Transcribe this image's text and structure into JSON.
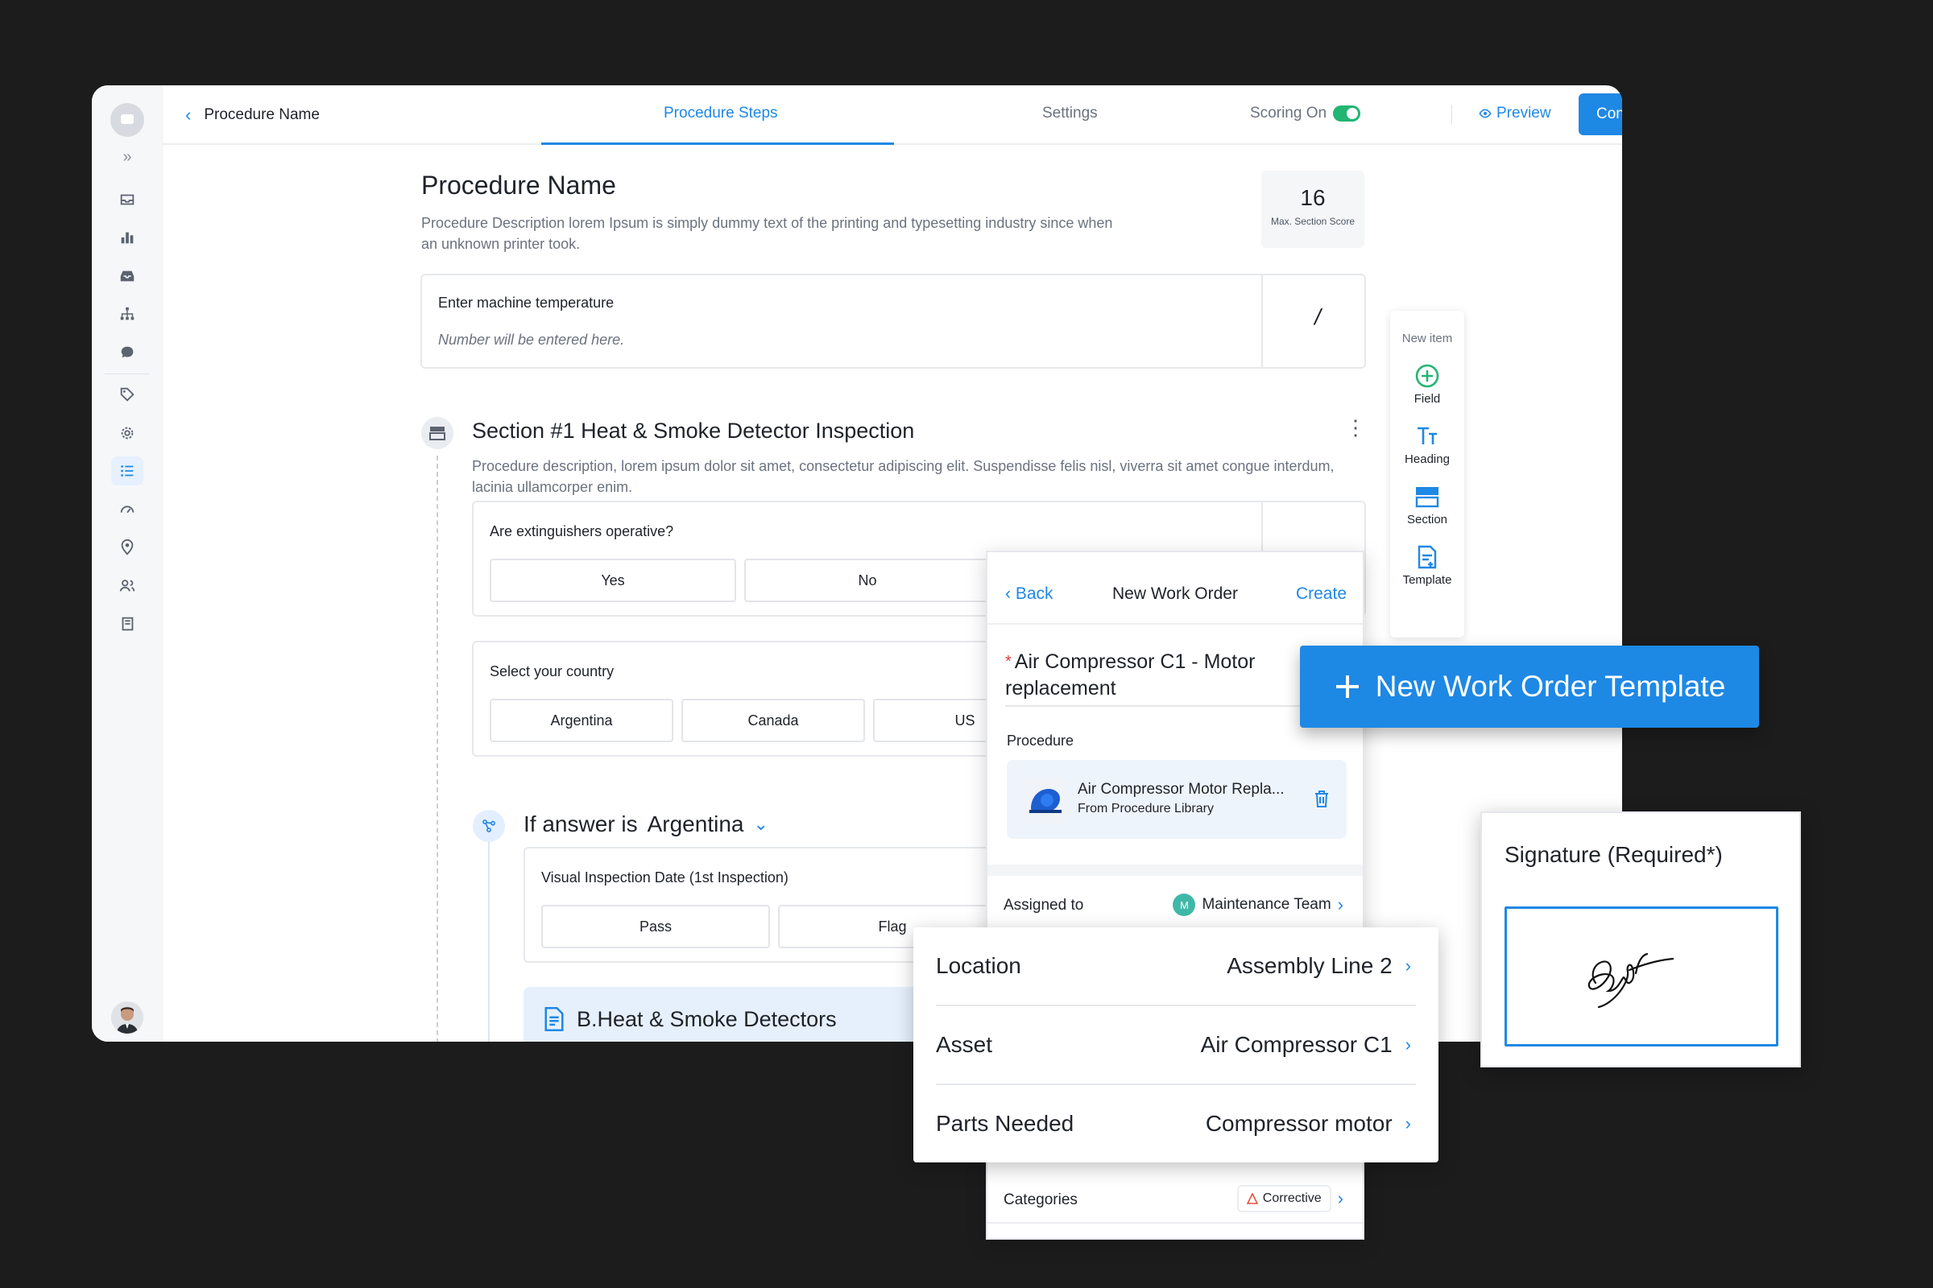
{
  "colors": {
    "accent": "#1e88e5",
    "toggle_on": "#22b573",
    "background": "#1c1c1c"
  },
  "topbar": {
    "back_label": "Procedure Name",
    "tabs": [
      {
        "label": "Procedure Steps",
        "active": true
      },
      {
        "label": "Settings",
        "active": false
      }
    ],
    "scoring_label": "Scoring On",
    "scoring_on": true,
    "preview_label": "Preview",
    "continue_label": "Continue"
  },
  "sidebar": {
    "icons": [
      "inbox-icon",
      "bar-chart-icon",
      "tray-icon",
      "hierarchy-icon",
      "chat-icon",
      "tag-icon",
      "gear-icon",
      "list-icon",
      "gauge-icon",
      "location-pin-icon",
      "users-icon",
      "book-icon"
    ],
    "active": "list-icon"
  },
  "procedure": {
    "title": "Procedure Name",
    "description": "Procedure Description lorem Ipsum is simply dummy text of the printing and typesetting industry since when an unknown printer took.",
    "max_score": "16",
    "max_score_label": "Max. Section Score",
    "field_label": "Enter machine temperature",
    "field_placeholder": "Number will be entered here.",
    "field_score": "/"
  },
  "section": {
    "title": "Section #1 Heat & Smoke Detector Inspection",
    "description": "Procedure description, lorem ipsum dolor sit amet, consectetur adipiscing elit. Suspendisse felis nisl, viverra sit amet congue interdum, lacinia ullamcorper enim.",
    "q1": {
      "label": "Are extinguishers operative?",
      "options": [
        "Yes",
        "No"
      ]
    },
    "q2": {
      "label": "Select your country",
      "options": [
        "Argentina",
        "Canada",
        "US"
      ]
    },
    "condition": {
      "prefix": "If answer is",
      "value": "Argentina"
    },
    "q3": {
      "label": "Visual Inspection Date (1st Inspection)",
      "options": [
        "Pass",
        "Flag"
      ]
    },
    "template_label": "B.Heat & Smoke Detectors"
  },
  "new_item": {
    "heading": "New item",
    "items": [
      "Field",
      "Heading",
      "Section",
      "Template"
    ]
  },
  "work_order": {
    "back": "Back",
    "title": "New Work Order",
    "create": "Create",
    "name": "Air Compressor C1 - Motor replacement",
    "procedure_label": "Procedure",
    "procedure_name": "Air Compressor Motor Repla...",
    "procedure_source": "From Procedure Library",
    "assigned_label": "Assigned to",
    "assigned_initial": "M",
    "assigned_value": "Maintenance Team",
    "categories_label": "Categories",
    "categories_value": "Corrective"
  },
  "details": [
    {
      "label": "Location",
      "value": "Assembly Line 2"
    },
    {
      "label": "Asset",
      "value": "Air Compressor C1"
    },
    {
      "label": "Parts Needed",
      "value": "Compressor motor"
    }
  ],
  "banner": {
    "label": "New Work Order Template"
  },
  "signature": {
    "title": "Signature (Required*)"
  }
}
